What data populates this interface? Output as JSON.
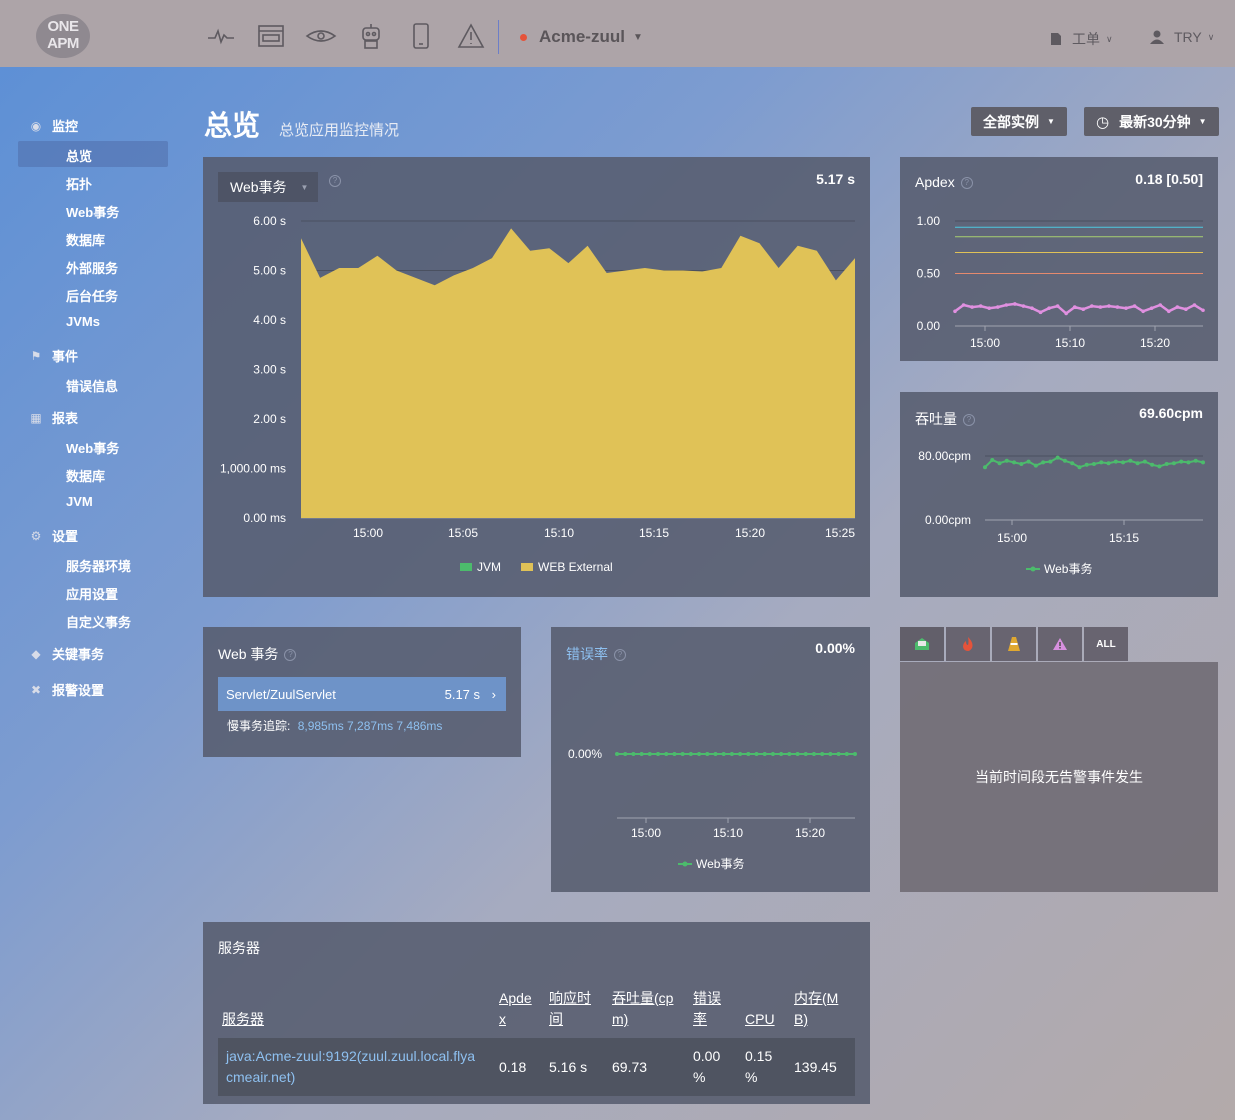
{
  "brand": {
    "logo_line1": "ONE",
    "logo_line2": "APM"
  },
  "topbar": {
    "icons": [
      "pulse-icon",
      "browser-icon",
      "eye-icon",
      "robot-icon",
      "mobile-icon",
      "alert-icon"
    ],
    "app_name": "Acme-zuul",
    "app_status_color": "#e5533a",
    "ticket_label": "工单",
    "user_label": "TRY"
  },
  "sidebar": {
    "monitor": {
      "label": "监控",
      "icon": "eye-icon",
      "items": [
        "总览",
        "拓扑",
        "Web事务",
        "数据库",
        "外部服务",
        "后台任务",
        "JVMs"
      ],
      "active": "总览"
    },
    "events": {
      "label": "事件",
      "icon": "flag-icon",
      "items": [
        "错误信息"
      ]
    },
    "reports": {
      "label": "报表",
      "icon": "table-icon",
      "items": [
        "Web事务",
        "数据库",
        "JVM"
      ]
    },
    "settings": {
      "label": "设置",
      "icon": "gear-icon",
      "items": [
        "服务器环境",
        "应用设置",
        "自定义事务"
      ]
    },
    "key_tx": {
      "label": "关键事务",
      "icon": "diamond-icon"
    },
    "alerts": {
      "label": "报警设置",
      "icon": "wrench-icon"
    }
  },
  "header": {
    "title": "总览",
    "subtitle": "总览应用监控情况",
    "instances_button": "全部实例",
    "time_button": "最新30分钟"
  },
  "web_chart_panel": {
    "selector": "Web事务",
    "value": "5.17 s",
    "legend": [
      {
        "label": "JVM",
        "color": "#4cbb6c"
      },
      {
        "label": "WEB External",
        "color": "#e0c257"
      }
    ]
  },
  "apdex_panel": {
    "title": "Apdex",
    "value": "0.18 [0.50]"
  },
  "throughput_panel": {
    "title": "吞吐量",
    "value": "69.60cpm",
    "legend": "Web事务"
  },
  "web_tx_panel": {
    "title": "Web 事务",
    "row_name": "Servlet/ZuulServlet",
    "row_value": "5.17 s",
    "slow_label": "慢事务追踪:",
    "slow_links": "8,985ms 7,287ms 7,486ms"
  },
  "error_panel": {
    "title": "错误率",
    "value": "0.00%",
    "legend": "Web事务"
  },
  "alerts_panel": {
    "tabs": [
      "inbox-icon",
      "fire-icon",
      "cone-icon",
      "warning-icon",
      "ALL"
    ],
    "empty_message": "当前时间段无告警事件发生"
  },
  "server_panel": {
    "title": "服务器",
    "columns": [
      "服务器",
      "Apdex",
      "响应时间",
      "吞吐量(cpm)",
      "错误率",
      "CPU",
      "内存(MB)"
    ],
    "column_display": [
      "服务器",
      "Apde\nx",
      "响应时\n间",
      "吞吐量(cp\nm)",
      "错误\n率",
      "CPU",
      "内存(M\nB)"
    ],
    "rows": [
      {
        "server": "java:Acme-zuul:9192(zuul.zuul.local.flyacmeair.net)",
        "server_display": "java:Acme-zuul:9192(zuul.zuul.local.flya\ncmeair.net)",
        "apdex": "0.18",
        "response": "5.16 s",
        "throughput": "69.73",
        "error": "0.00 %",
        "cpu": "0.15 %",
        "memory": "139.45"
      }
    ]
  },
  "chart_data": [
    {
      "type": "area",
      "title": "Web事务",
      "x_ticks": [
        "15:00",
        "15:05",
        "15:10",
        "15:15",
        "15:20",
        "15:25"
      ],
      "y_ticks": [
        "0.00 ms",
        "1,000.00 ms",
        "2.00 s",
        "3.00 s",
        "4.00 s",
        "5.00 s",
        "6.00 s"
      ],
      "ylim": [
        0,
        6
      ],
      "yunit": "s",
      "series": [
        {
          "name": "WEB External",
          "color": "#e0c257",
          "values": [
            5.65,
            4.85,
            5.05,
            5.05,
            5.3,
            5.0,
            4.85,
            4.7,
            4.9,
            5.05,
            5.25,
            5.85,
            5.4,
            5.45,
            5.15,
            5.5,
            4.95,
            5.0,
            5.05,
            5.0,
            5.0,
            4.98,
            5.05,
            5.7,
            5.55,
            5.05,
            5.5,
            5.4,
            4.8,
            5.25
          ]
        },
        {
          "name": "JVM",
          "color": "#4cbb6c",
          "values": []
        }
      ]
    },
    {
      "type": "line",
      "title": "Apdex",
      "x_ticks": [
        "15:00",
        "15:10",
        "15:20"
      ],
      "y_ticks": [
        "0.00",
        "0.50",
        "1.00"
      ],
      "ylim": [
        0,
        1
      ],
      "reference_lines": [
        {
          "value": 0.94,
          "color": "#4dc8e0"
        },
        {
          "value": 0.85,
          "color": "#a8d070"
        },
        {
          "value": 0.7,
          "color": "#e0c257"
        },
        {
          "value": 0.5,
          "color": "#e58a6e"
        }
      ],
      "series": [
        {
          "name": "Apdex",
          "color": "#e090e0",
          "values": [
            0.14,
            0.2,
            0.18,
            0.19,
            0.17,
            0.18,
            0.2,
            0.21,
            0.19,
            0.17,
            0.13,
            0.17,
            0.19,
            0.12,
            0.18,
            0.16,
            0.19,
            0.18,
            0.19,
            0.18,
            0.17,
            0.19,
            0.14,
            0.17,
            0.2,
            0.14,
            0.18,
            0.16,
            0.2,
            0.15
          ]
        }
      ]
    },
    {
      "type": "line",
      "title": "吞吐量",
      "x_ticks": [
        "15:00",
        "15:15"
      ],
      "y_ticks": [
        "0.00cpm",
        "80.00cpm"
      ],
      "ylim": [
        0,
        80
      ],
      "series": [
        {
          "name": "Web事务",
          "color": "#4cbb6c",
          "values": [
            66,
            75,
            71,
            74,
            72,
            70,
            73,
            68,
            72,
            73,
            78,
            74,
            71,
            66,
            69,
            70,
            72,
            71,
            73,
            72,
            74,
            71,
            73,
            69,
            67,
            70,
            71,
            73,
            72,
            74,
            72
          ]
        }
      ]
    },
    {
      "type": "line",
      "title": "错误率",
      "x_ticks": [
        "15:00",
        "15:10",
        "15:20"
      ],
      "y_ticks": [
        "0.00%"
      ],
      "series": [
        {
          "name": "Web事务",
          "color": "#4cbb6c",
          "values": [
            0,
            0,
            0,
            0,
            0,
            0,
            0,
            0,
            0,
            0,
            0,
            0,
            0,
            0,
            0,
            0,
            0,
            0,
            0,
            0,
            0,
            0,
            0,
            0,
            0,
            0,
            0,
            0,
            0,
            0
          ]
        }
      ]
    }
  ]
}
